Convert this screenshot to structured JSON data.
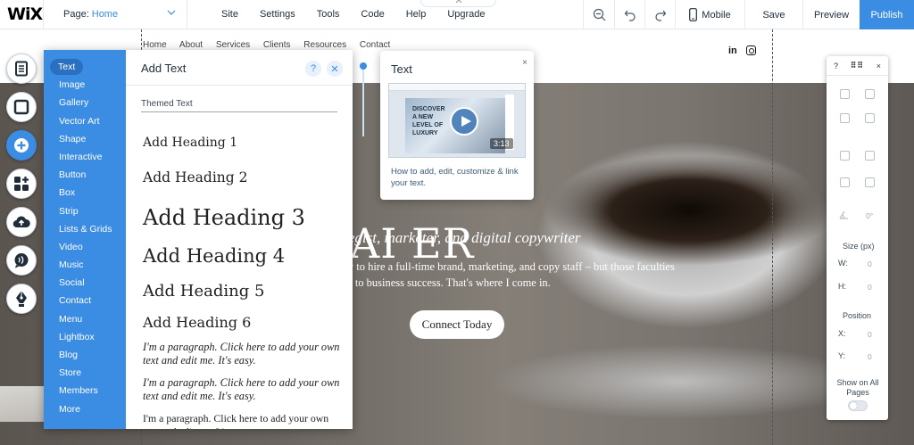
{
  "topbar": {
    "logo": "WiX",
    "page_label": "Page:",
    "page_value": "Home",
    "menu": [
      "Site",
      "Settings",
      "Tools",
      "Code",
      "Help",
      "Upgrade"
    ],
    "mobile_label": "Mobile",
    "save_label": "Save",
    "preview_label": "Preview",
    "publish_label": "Publish",
    "accent_color": "#3b8ce3"
  },
  "site": {
    "nav": "Home About Services Clients Resources Contact",
    "social": [
      "in"
    ],
    "hero_title": "AI      ER",
    "hero_subtitle": "rategist, marketer, and digital copywriter",
    "hero_body_1": "apacity to hire a full-time brand, marketing, and copy staff – but those faculties",
    "hero_body_2": "critical to business success. That's where I come in.",
    "cta_label": "Connect Today"
  },
  "rail": {
    "icons": [
      "pages-icon",
      "background-icon",
      "add-icon",
      "app-market-icon",
      "upload-icon",
      "chat-icon",
      "pen-icon"
    ]
  },
  "add_panel": {
    "categories": [
      "Text",
      "Image",
      "Gallery",
      "Vector Art",
      "Shape",
      "Interactive",
      "Button",
      "Box",
      "Strip",
      "Lists & Grids",
      "Video",
      "Music",
      "Social",
      "Contact",
      "Menu",
      "Lightbox",
      "Blog",
      "Store",
      "Members",
      "More"
    ],
    "title": "Add Text",
    "help_label": "?",
    "close_label": "✕",
    "themed_label": "Themed Text",
    "headings": [
      "Add Heading 1",
      "Add Heading 2",
      "Add Heading 3",
      "Add Heading 4",
      "Add Heading 5",
      "Add Heading 6"
    ],
    "paragraph_1": "I'm a paragraph. Click here to add your own text and edit me. It's easy.",
    "paragraph_2": "I'm a paragraph. Click here to add your own text and edit me. It's easy.",
    "paragraph_3": "I'm a paragraph. Click here to add your own text and edit me. It's easy."
  },
  "tooltip": {
    "title": "Text",
    "close_label": "×",
    "thumb_text": "DISCOVER A NEW LEVEL OF LUXURY",
    "duration": "3:13",
    "description": "How to add, edit, customize & link your text."
  },
  "right_panel": {
    "help_label": "?",
    "close_label": "×",
    "rotation_value": "0°",
    "size_label": "Size (px)",
    "width_label": "W:",
    "width_value": "0",
    "height_label": "H:",
    "height_value": "0",
    "position_label": "Position",
    "x_label": "X:",
    "x_value": "0",
    "y_label": "Y:",
    "y_value": "0",
    "show_all_label": "Show on All Pages"
  }
}
